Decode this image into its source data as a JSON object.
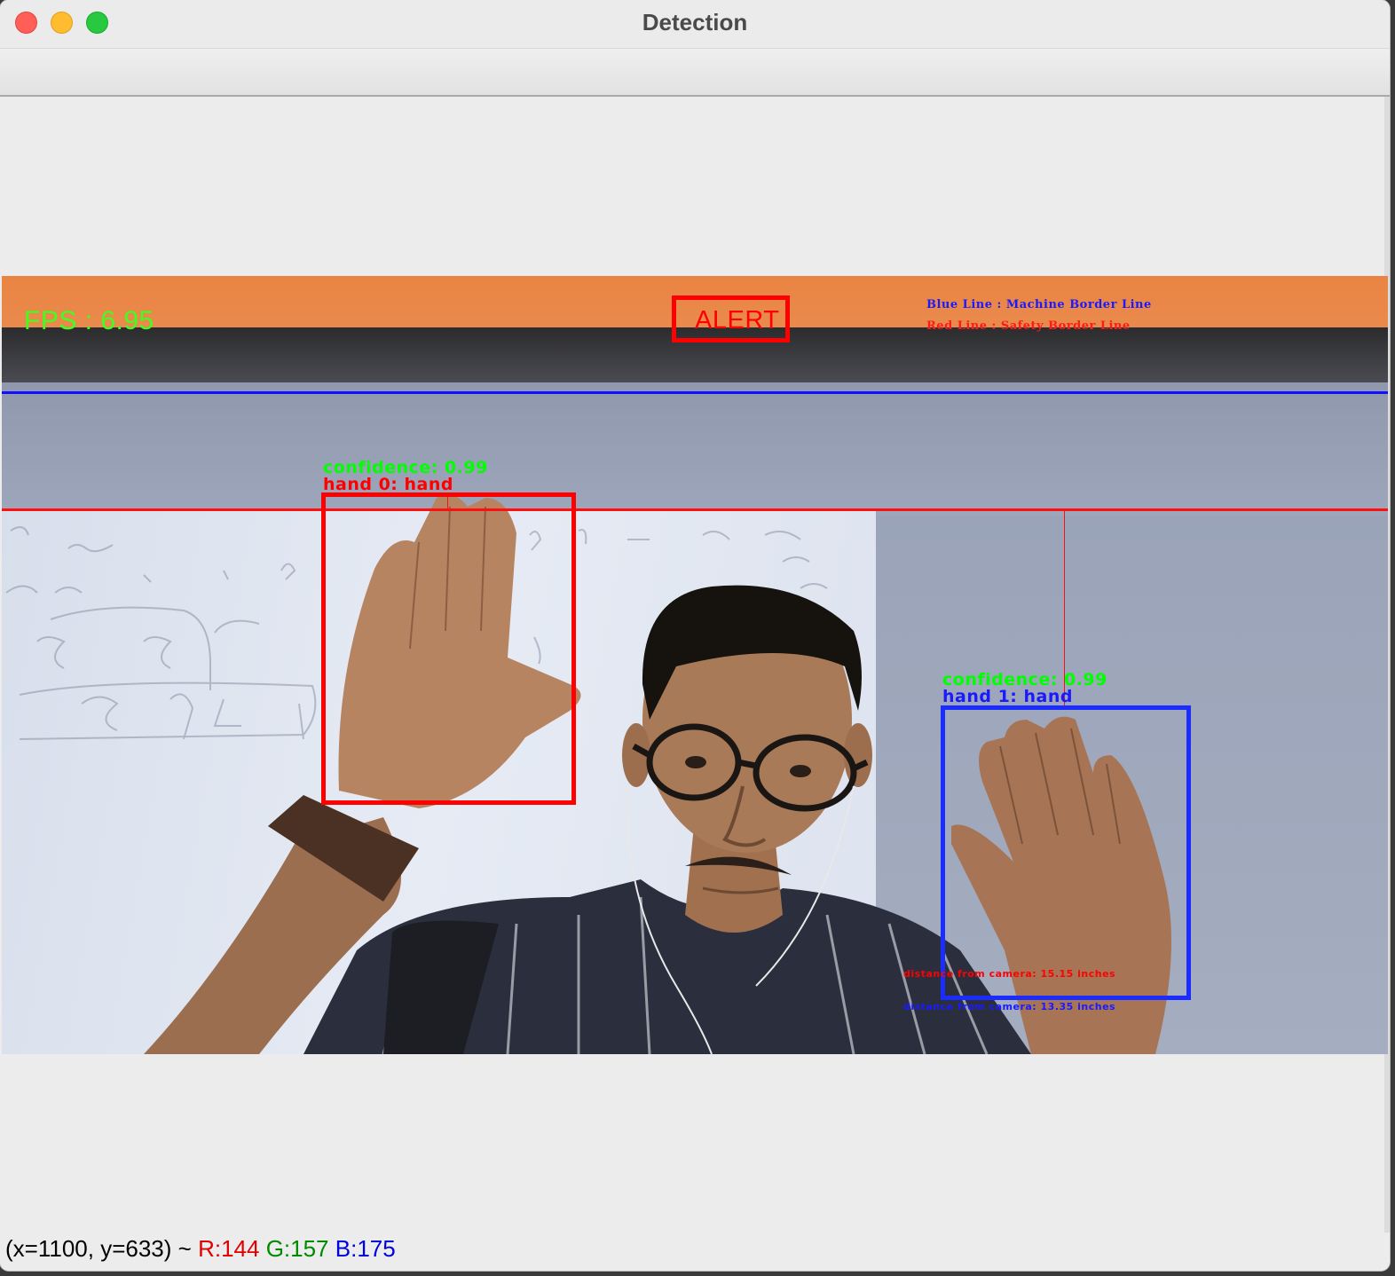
{
  "window": {
    "title": "Detection"
  },
  "overlay": {
    "fps": "FPS : 6.95",
    "alert": "ALERT",
    "legend_blue": "Blue Line : Machine Border Line",
    "legend_red": "Red Line : Safety Border Line",
    "hands": [
      {
        "confidence": "confidence: 0.99",
        "label": "hand 0: hand",
        "color": "#ff0000"
      },
      {
        "confidence": "confidence: 0.99",
        "label": "hand 1: hand",
        "color": "#1a2cff"
      }
    ],
    "distance_red": "distance from camera: 15.15 inches",
    "distance_blue": "distance from camera: 13.35 inches",
    "machine_border_color": "#1010ff",
    "safety_border_color": "#ff1010"
  },
  "status": {
    "coords": "(x=1100, y=633) ~",
    "r": "R:144",
    "g": "G:157",
    "b": "B:175"
  }
}
